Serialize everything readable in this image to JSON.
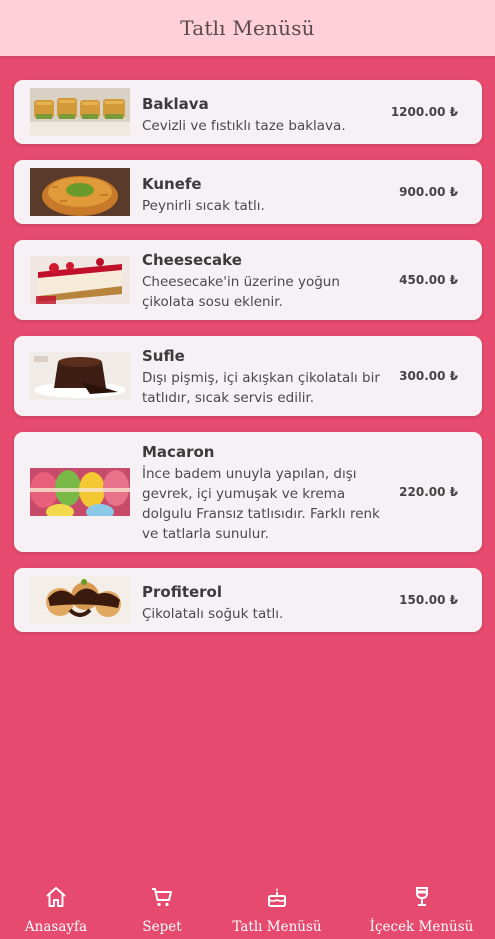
{
  "header": {
    "title": "Tatlı Menüsü"
  },
  "menu": [
    {
      "name": "Baklava",
      "desc": "Cevizli ve fıstıklı taze baklava.",
      "price": "1200.00 ₺",
      "image": "baklava-image"
    },
    {
      "name": "Kunefe",
      "desc": "Peynirli sıcak tatlı.",
      "price": "900.00 ₺",
      "image": "kunefe-image"
    },
    {
      "name": "Cheesecake",
      "desc": "Cheesecake'in üzerine yoğun çikolata sosu eklenir.",
      "price": "450.00 ₺",
      "image": "cheesecake-image"
    },
    {
      "name": "Sufle",
      "desc": "Dışı pişmiş, içi akışkan çikolatalı bir tatlıdır, sıcak servis edilir.",
      "price": "300.00 ₺",
      "image": "sufle-image"
    },
    {
      "name": "Macaron",
      "desc": "İnce badem unuyla yapılan, dışı gevrek, içi yumuşak ve krema dolgulu Fransız tatlısıdır. Farklı renk ve tatlarla sunulur.",
      "price": "220.00 ₺",
      "image": "macaron-image"
    },
    {
      "name": "Profiterol",
      "desc": "Çikolatalı soğuk tatlı.",
      "price": "150.00 ₺",
      "image": "profiterol-image"
    }
  ],
  "nav": [
    {
      "label": "Anasayfa",
      "icon": "home-icon"
    },
    {
      "label": "Sepet",
      "icon": "cart-icon"
    },
    {
      "label": "Tatlı Menüsü",
      "icon": "cake-icon"
    },
    {
      "label": "İçecek Menüsü",
      "icon": "wine-glass-icon"
    }
  ],
  "colors": {
    "background": "#e64a6e",
    "header": "#fdd0da",
    "card": "#f6f1f4"
  }
}
